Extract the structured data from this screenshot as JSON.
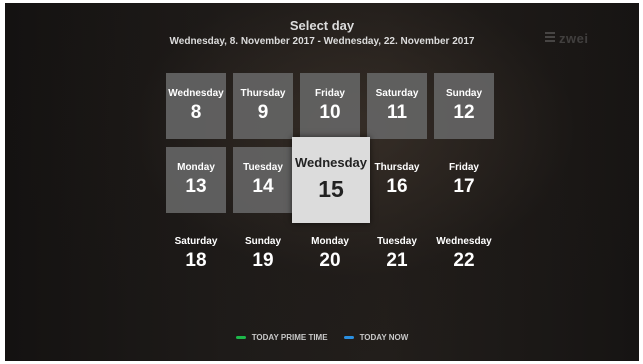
{
  "header": {
    "title": "Select day",
    "range": "Wednesday, 8. November 2017 - Wednesday, 22. November 2017"
  },
  "logo": {
    "text": "zwei"
  },
  "days": [
    {
      "weekday": "Wednesday",
      "date": "8",
      "state": "past"
    },
    {
      "weekday": "Thursday",
      "date": "9",
      "state": "past"
    },
    {
      "weekday": "Friday",
      "date": "10",
      "state": "past"
    },
    {
      "weekday": "Saturday",
      "date": "11",
      "state": "past"
    },
    {
      "weekday": "Sunday",
      "date": "12",
      "state": "past"
    },
    {
      "weekday": "Monday",
      "date": "13",
      "state": "past"
    },
    {
      "weekday": "Tuesday",
      "date": "14",
      "state": "past"
    },
    {
      "weekday": "Wednesday",
      "date": "15",
      "state": "selected"
    },
    {
      "weekday": "Thursday",
      "date": "16",
      "state": "future"
    },
    {
      "weekday": "Friday",
      "date": "17",
      "state": "future"
    },
    {
      "weekday": "Saturday",
      "date": "18",
      "state": "future"
    },
    {
      "weekday": "Sunday",
      "date": "19",
      "state": "future"
    },
    {
      "weekday": "Monday",
      "date": "20",
      "state": "future"
    },
    {
      "weekday": "Tuesday",
      "date": "21",
      "state": "future"
    },
    {
      "weekday": "Wednesday",
      "date": "22",
      "state": "future"
    }
  ],
  "legend": [
    {
      "label": "TODAY PRIME TIME",
      "color": "#1db84a"
    },
    {
      "label": "TODAY NOW",
      "color": "#2a8fe0"
    }
  ],
  "colors": {
    "tile_past": "#646464",
    "tile_selected": "#dcdcdc",
    "text_light": "#ffffff",
    "text_dark": "#222222"
  }
}
